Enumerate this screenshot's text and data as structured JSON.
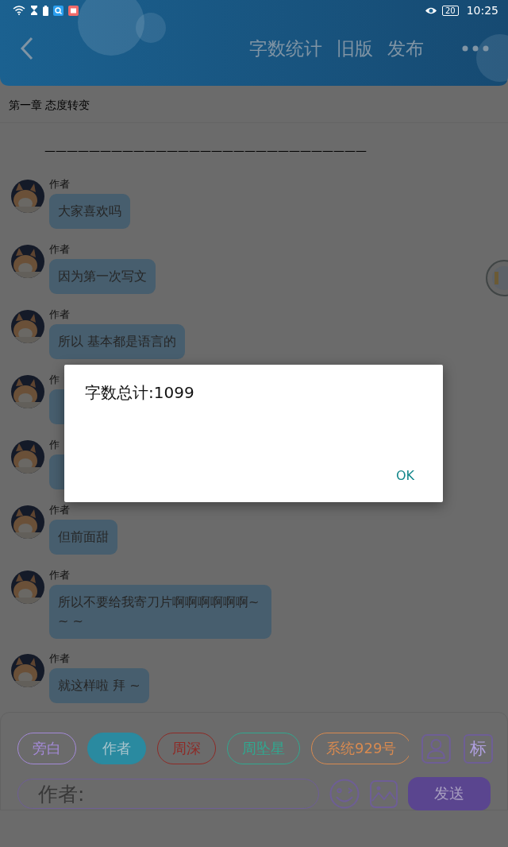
{
  "status_bar": {
    "time": "10:25",
    "battery": "20"
  },
  "header": {
    "actions": [
      "字数统计",
      "旧版",
      "发布"
    ]
  },
  "chapter_title": "第一章 态度转变",
  "divider_text": "—————————————————————————————",
  "messages": [
    {
      "sender": "作者",
      "text": "大家喜欢吗"
    },
    {
      "sender": "作者",
      "text": "因为第一次写文"
    },
    {
      "sender": "作者",
      "text": "所以 基本都是语言的"
    },
    {
      "sender": "作",
      "kind": "covered"
    },
    {
      "sender": "作",
      "kind": "covered"
    },
    {
      "sender": "作者",
      "text": "但前面甜"
    },
    {
      "sender": "作者",
      "text": "所以不要给我寄刀片啊啊啊啊啊啊~ ~ ~"
    },
    {
      "sender": "作者",
      "text": "就这样啦 拜 ~"
    }
  ],
  "roles": [
    {
      "label": "旁白",
      "selected": false,
      "color": "#a48ad8"
    },
    {
      "label": "作者",
      "selected": true,
      "color": "#2a8aa0"
    },
    {
      "label": "周深",
      "selected": false,
      "color": "#8e2a26"
    },
    {
      "label": "周坠星",
      "selected": false,
      "color": "#30a890"
    },
    {
      "label": "系统929号",
      "selected": false,
      "color": "#d88a50"
    }
  ],
  "tag_button": "标",
  "input": {
    "placeholder": "作者:"
  },
  "send_button": "发送",
  "dialog": {
    "message": "字数总计:1099",
    "button": "OK"
  }
}
